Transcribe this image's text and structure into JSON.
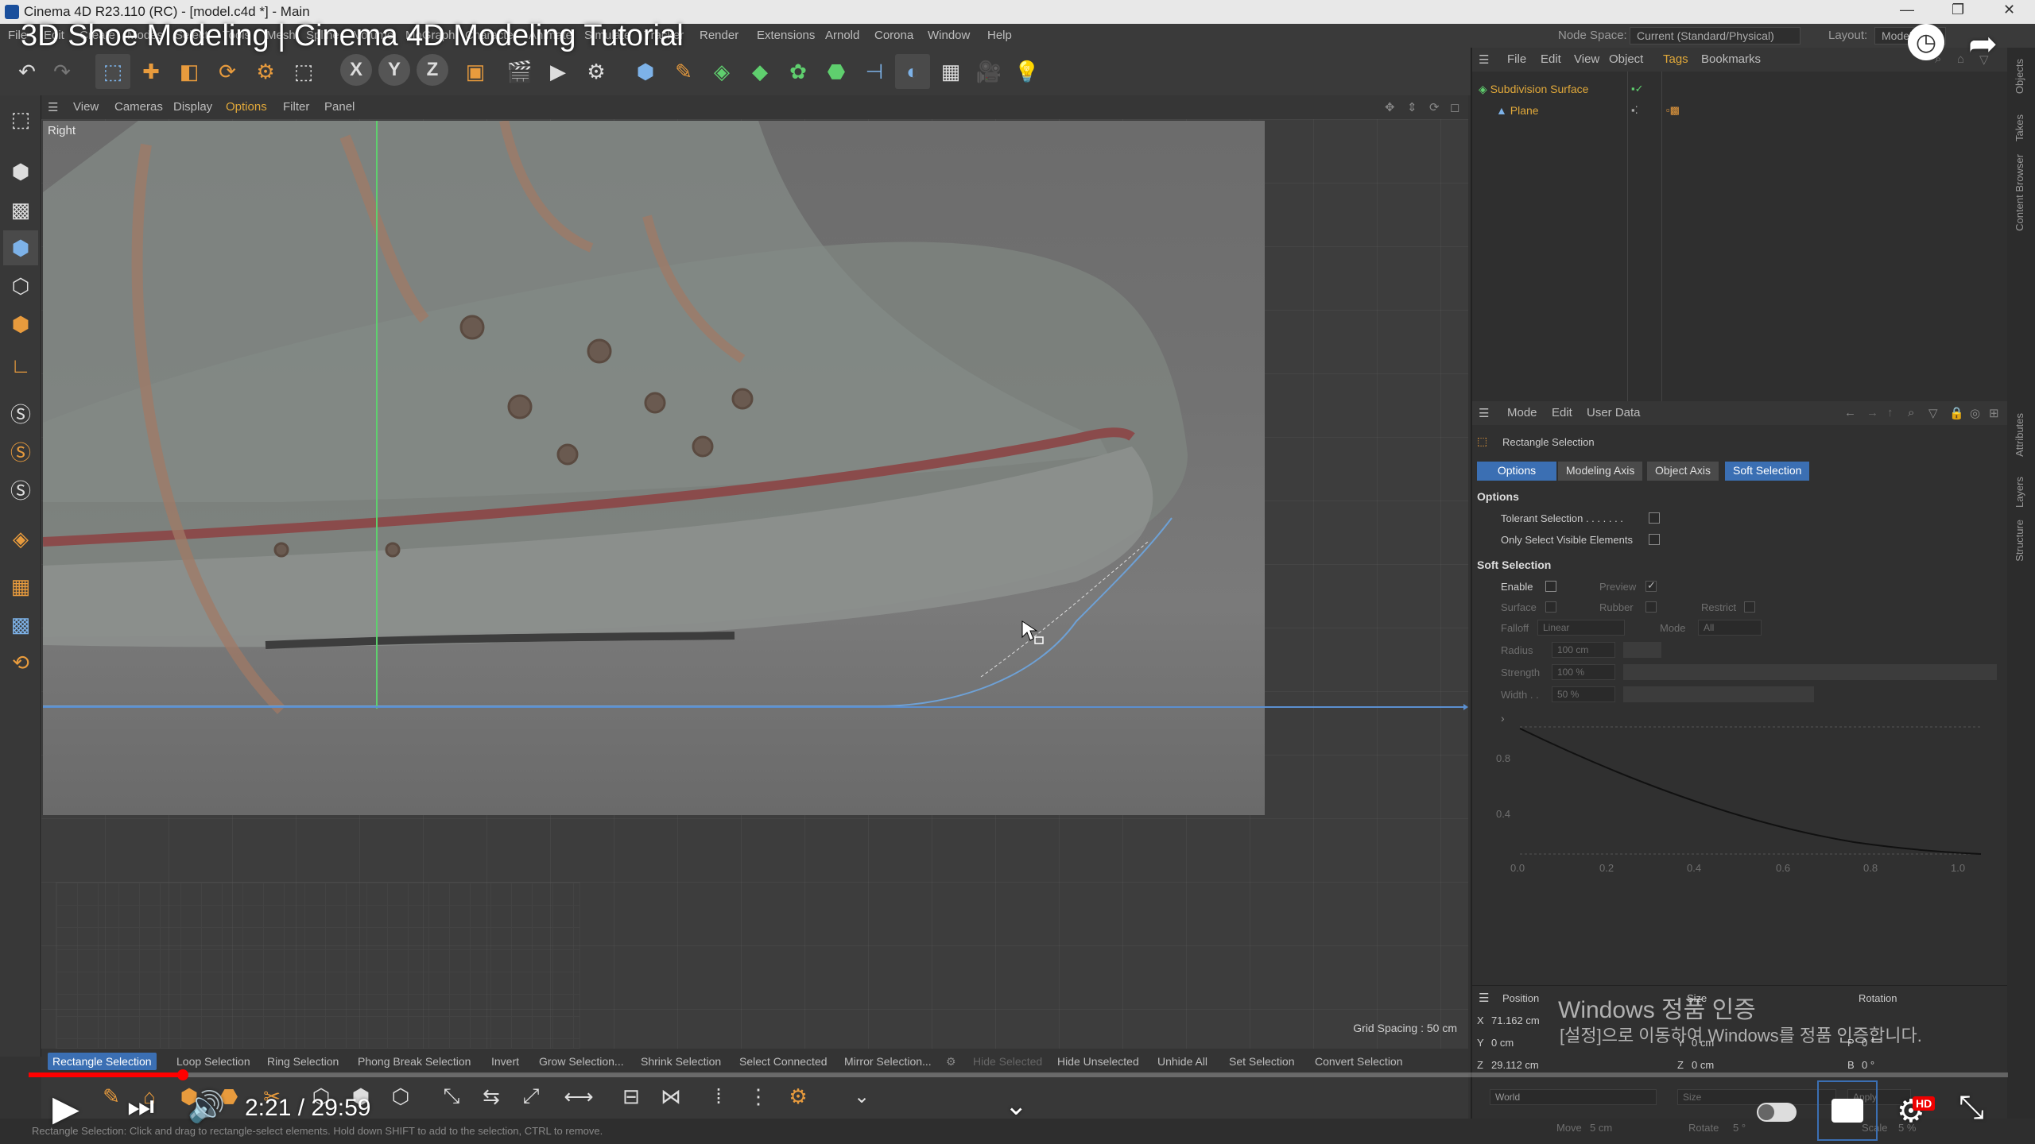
{
  "window": {
    "title": "Cinema 4D R23.110 (RC) - [model.c4d *] - Main",
    "controls": [
      "—",
      "❐",
      "✕"
    ]
  },
  "menubar": {
    "items": [
      "File",
      "Edit",
      "Create",
      "Modes",
      "Select",
      "Tools",
      "Mesh",
      "Spline",
      "Volume",
      "MoGraph",
      "Character",
      "Animate",
      "Simulate",
      "Tracker",
      "Render",
      "Extensions",
      "Arnold",
      "Corona",
      "Window",
      "Help"
    ],
    "node_space_label": "Node Space:",
    "node_space_value": "Current (Standard/Physical)",
    "layout_label": "Layout:",
    "layout_value": "Model"
  },
  "video": {
    "title": "3D Shoe Modeling | Cinema 4D Modeling Tutorial",
    "time": "2:21 / 29:59",
    "progress": 0.078,
    "hd_badge": "HD"
  },
  "viewport": {
    "menu": [
      "View",
      "Cameras",
      "Display",
      "Options",
      "Filter",
      "Panel"
    ],
    "active_menu": "Options",
    "view_label": "Right",
    "grid_spacing": "Grid Spacing : 50 cm"
  },
  "selection_bar": {
    "items": [
      "Rectangle Selection",
      "Loop Selection",
      "Ring Selection",
      "Phong Break Selection",
      "Invert",
      "Grow Selection...",
      "Shrink Selection",
      "Select Connected",
      "Mirror Selection...",
      "Hide Selected",
      "Hide Unselected",
      "Unhide All",
      "Set Selection",
      "Convert Selection"
    ],
    "active": "Rectangle Selection",
    "disabled": "Hide Selected"
  },
  "status_bar": {
    "text": "Rectangle Selection: Click and drag to rectangle-select elements. Hold down SHIFT to add to the selection, CTRL to remove."
  },
  "object_manager": {
    "menu": [
      "File",
      "Edit",
      "View",
      "Object",
      "Tags",
      "Bookmarks"
    ],
    "objects": [
      "Subdivision Surface",
      "Plane"
    ]
  },
  "attribute_manager": {
    "menu": [
      "Mode",
      "Edit",
      "User Data"
    ],
    "tool_name": "Rectangle Selection",
    "tabs": [
      "Options",
      "Modeling Axis",
      "Object Axis",
      "Soft Selection"
    ],
    "options_header": "Options",
    "tolerant_selection": "Tolerant Selection . . . . . . .",
    "only_visible": "Only Select Visible Elements",
    "soft_header": "Soft Selection",
    "enable": "Enable",
    "preview": "Preview",
    "surface": "Surface",
    "rubber": "Rubber",
    "restrict": "Restrict",
    "falloff_label": "Falloff",
    "falloff_value": "Linear",
    "mode_label": "Mode",
    "mode_value": "All",
    "radius_label": "Radius",
    "radius_value": "100 cm",
    "strength_label": "Strength",
    "strength_value": "100 %",
    "width_label": "Width . .",
    "width_value": "50 %",
    "graph_y_ticks": [
      "0.8",
      "0.4"
    ],
    "graph_x_ticks": [
      "0.0",
      "0.2",
      "0.4",
      "0.6",
      "0.8",
      "1.0"
    ]
  },
  "coordinates": {
    "position_label": "Position",
    "size_label": "Size",
    "rotation_label": "Rotation",
    "x": "71.162 cm",
    "y": "0 cm",
    "z": "29.112 cm",
    "sy": "0 cm",
    "sz": "0 cm",
    "p": "0 °",
    "b": "0 °",
    "world": "World",
    "size_mode": "Size",
    "apply": "Apply",
    "move_label": "Move",
    "move_value": "5 cm",
    "rotate_label": "Rotate",
    "rotate_value": "5 °",
    "scale_label": "Scale",
    "scale_value": "5 %"
  },
  "right_tabs": [
    "Objects",
    "Takes",
    "Content Browser",
    "Attributes",
    "Layers",
    "Structure"
  ],
  "windows_activation": {
    "line1": "Windows 정품 인증",
    "line2": "[설정]으로 이동하여 Windows를 정품 인증합니다."
  }
}
